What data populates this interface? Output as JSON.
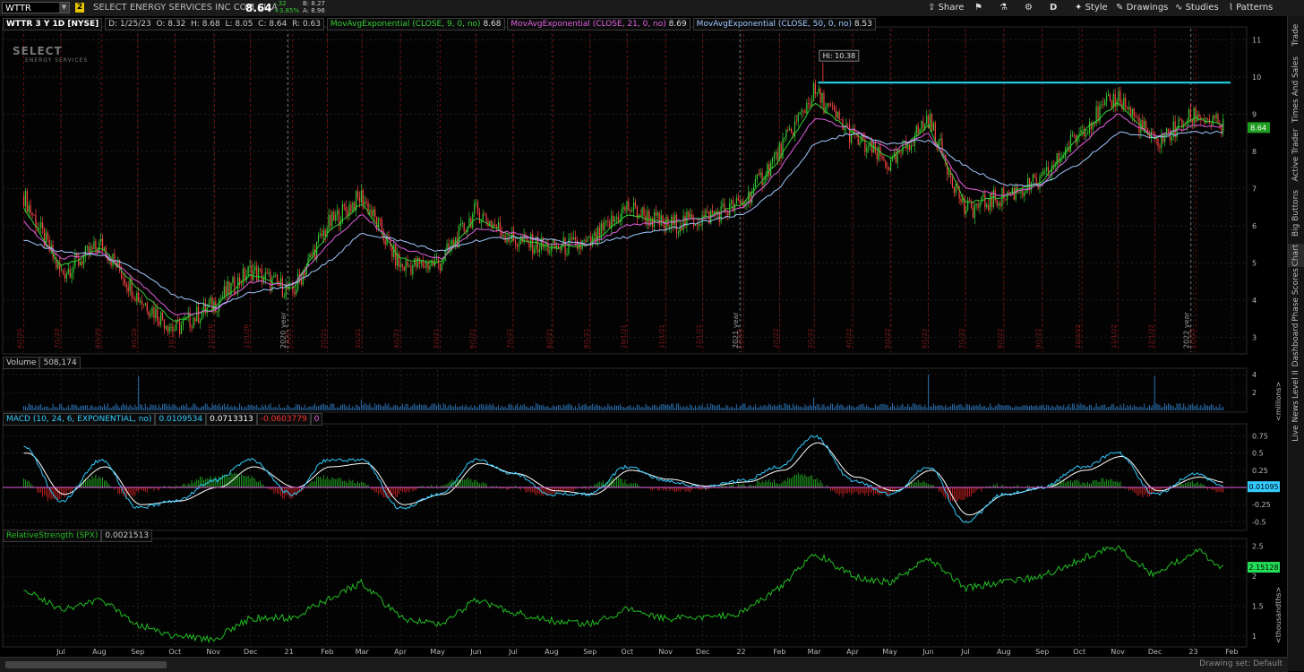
{
  "topbar": {
    "symbol": "WTTR",
    "link_number": "2",
    "company": "SELECT ENERGY SERVICES INC COM CL A",
    "last": "8.64",
    "change_abs": "-.32",
    "change_pct": "+3.85%",
    "bid": "B: 8.27",
    "ask": "A: 8.96",
    "share_label": "Share",
    "period_label": "D",
    "style_label": "Style",
    "drawings_label": "Drawings",
    "studies_label": "Studies",
    "patterns_label": "Patterns"
  },
  "price_pane": {
    "title": "WTTR 3 Y 1D [NYSE]",
    "ohlc": {
      "date": "D: 1/25/23",
      "open": "O: 8.32",
      "high": "H: 8.68",
      "low": "L: 8.05",
      "close": "C: 8.64",
      "range": "R: 0.63"
    },
    "studies": [
      {
        "label": "MovAvgExponential (CLOSE, 9, 0, no)",
        "value": "8.68",
        "color": "#33cc33"
      },
      {
        "label": "MovAvgExponential (CLOSE, 21, 0, no)",
        "value": "8.69",
        "color": "#e060e0"
      },
      {
        "label": "MovAvgExponential (CLOSE, 50, 0, no)",
        "value": "8.53",
        "color": "#a0c8ff"
      }
    ],
    "hi_label": "Hi: 10.38",
    "price_badge": "8.64",
    "watermark_line1": "SELECT",
    "watermark_line2": "ENERGY SERVICES",
    "y_ticks": [
      "11",
      "10",
      "9",
      "8",
      "7",
      "6",
      "5",
      "4",
      "3"
    ],
    "year_markers": [
      "2020 year",
      "2021 year",
      "2022 year"
    ],
    "date_markers": [
      "6/1/20",
      "7/1/20",
      "8/3/20",
      "9/1/20",
      "10/1/20",
      "11/2/20",
      "12/1/20",
      "1/4/21",
      "2/1/21",
      "3/1/21",
      "4/1/21",
      "5/3/21",
      "6/1/21",
      "7/1/21",
      "8/2/21",
      "9/1/21",
      "10/1/21",
      "11/1/21",
      "12/1/21",
      "1/3/22",
      "2/1/22",
      "3/1/22",
      "4/1/22",
      "5/2/22",
      "6/1/22",
      "7/1/22",
      "8/1/22",
      "9/1/22",
      "10/3/22",
      "11/1/22",
      "12/1/22",
      "1/3/23"
    ]
  },
  "volume_pane": {
    "title": "Volume",
    "value": "508,174",
    "y_ticks": [
      "4",
      "2"
    ],
    "unit_label": "<millions>"
  },
  "macd_pane": {
    "title": "MACD (10, 24, 6, EXPONENTIAL, no)",
    "values": [
      "0.0109534",
      "0.0713313",
      "-0.0603779",
      "0"
    ],
    "value_colors": [
      "#33ccff",
      "#ffffff",
      "#ff3333",
      "#e060e0"
    ],
    "y_ticks": [
      "0.75",
      "0.5",
      "0.25",
      "-0.25",
      "-0.5"
    ],
    "badge": "0.01095"
  },
  "rs_pane": {
    "title": "RelativeStrength (SPX)",
    "value": "0.0021513",
    "y_ticks": [
      "2.5",
      "2",
      "1.5",
      "1"
    ],
    "badge": "2.15128",
    "unit_label": "<thousandths>"
  },
  "x_axis": [
    "Jul",
    "Aug",
    "Sep",
    "Oct",
    "Nov",
    "Dec",
    "21",
    "Feb",
    "Mar",
    "Apr",
    "May",
    "Jun",
    "Jul",
    "Aug",
    "Sep",
    "Oct",
    "Nov",
    "Dec",
    "22",
    "Feb",
    "Mar",
    "Apr",
    "May",
    "Jun",
    "Jul",
    "Aug",
    "Sep",
    "Oct",
    "Nov",
    "Dec",
    "23",
    "Feb"
  ],
  "right_tabs": [
    "Trade",
    "Times And Sales",
    "Active Trader",
    "Big Buttons",
    "Chart",
    "Phase Scores",
    "Dashboard",
    "Level II",
    "Live News"
  ],
  "bottom": {
    "drawing_set": "Drawing set: Default"
  },
  "colors": {
    "up": "#33cc33",
    "down": "#ff4444",
    "ema9": "#33cc33",
    "ema21": "#e060e0",
    "ema50": "#a0c8ff",
    "resistance": "#22d3e6",
    "macd": "#33ccff",
    "signal": "#ffffff",
    "rs": "#22bb22"
  },
  "chart_data": [
    {
      "type": "candlestick",
      "title": "WTTR 3 Y 1D [NYSE]",
      "x": [
        "2020-06-01",
        "2020-07-01",
        "2020-08-03",
        "2020-09-01",
        "2020-10-01",
        "2020-11-02",
        "2020-12-01",
        "2021-01-04",
        "2021-02-01",
        "2021-03-01",
        "2021-04-01",
        "2021-05-03",
        "2021-06-01",
        "2021-07-01",
        "2021-08-02",
        "2021-09-01",
        "2021-10-01",
        "2021-11-01",
        "2021-12-01",
        "2022-01-03",
        "2022-02-01",
        "2022-03-01",
        "2022-04-01",
        "2022-05-02",
        "2022-06-01",
        "2022-07-01",
        "2022-08-01",
        "2022-09-01",
        "2022-10-03",
        "2022-11-01",
        "2022-12-01",
        "2023-01-03",
        "2023-01-25"
      ],
      "series": [
        {
          "name": "Close",
          "values": [
            6.8,
            4.7,
            5.5,
            4.1,
            3.2,
            3.9,
            4.8,
            4.2,
            6.0,
            6.8,
            4.9,
            5.0,
            6.4,
            5.6,
            5.4,
            5.5,
            6.5,
            6.0,
            6.2,
            6.6,
            8.0,
            9.6,
            8.4,
            7.6,
            8.9,
            6.4,
            6.8,
            7.2,
            8.6,
            9.5,
            8.2,
            9.0,
            8.64
          ]
        },
        {
          "name": "MovAvgExponential (CLOSE, 9, 0, no)",
          "values": [
            6.5,
            4.9,
            5.4,
            4.3,
            3.4,
            3.8,
            4.7,
            4.3,
            5.8,
            6.6,
            5.1,
            5.0,
            6.2,
            5.7,
            5.4,
            5.5,
            6.3,
            6.1,
            6.2,
            6.6,
            7.8,
            9.3,
            8.5,
            7.8,
            8.7,
            6.6,
            6.8,
            7.2,
            8.5,
            9.3,
            8.3,
            8.9,
            8.68
          ]
        },
        {
          "name": "MovAvgExponential (CLOSE, 21, 0, no)",
          "values": [
            6.1,
            5.1,
            5.3,
            4.5,
            3.6,
            3.7,
            4.5,
            4.4,
            5.5,
            6.3,
            5.4,
            5.1,
            5.9,
            5.8,
            5.5,
            5.5,
            6.0,
            6.1,
            6.2,
            6.5,
            7.5,
            8.9,
            8.6,
            8.0,
            8.5,
            7.0,
            6.8,
            7.1,
            8.2,
            9.0,
            8.4,
            8.7,
            8.69
          ]
        },
        {
          "name": "MovAvgExponential (CLOSE, 50, 0, no)",
          "values": [
            5.6,
            5.3,
            5.2,
            4.8,
            4.1,
            3.8,
            4.2,
            4.4,
            5.0,
            5.8,
            5.6,
            5.3,
            5.6,
            5.7,
            5.6,
            5.5,
            5.7,
            5.9,
            6.1,
            6.3,
            7.0,
            8.2,
            8.5,
            8.2,
            8.3,
            7.6,
            7.1,
            7.1,
            7.7,
            8.5,
            8.4,
            8.5,
            8.53
          ]
        }
      ],
      "resistance": 9.85,
      "annotation": {
        "x": "2022-03-08",
        "y": 10.38,
        "text": "Hi: 10.38"
      },
      "ylim": [
        2.6,
        11.3
      ]
    },
    {
      "type": "bar",
      "title": "Volume",
      "x": [
        "2020-06-01",
        "2020-09-01",
        "2020-12-01",
        "2021-03-01",
        "2021-06-01",
        "2021-09-01",
        "2021-12-01",
        "2022-03-01",
        "2022-06-01",
        "2022-09-01",
        "2022-12-01",
        "2023-01-25"
      ],
      "values": [
        0.6,
        3.8,
        0.5,
        1.2,
        0.6,
        0.4,
        0.6,
        1.4,
        4.0,
        0.8,
        3.8,
        0.51
      ],
      "ylim": [
        0,
        4.5
      ]
    },
    {
      "type": "line",
      "title": "MACD (10, 24, 6, EXPONENTIAL, no)",
      "x": [
        "2020-06-01",
        "2020-07-01",
        "2020-08-03",
        "2020-09-01",
        "2020-10-01",
        "2020-11-02",
        "2020-12-01",
        "2021-01-04",
        "2021-02-01",
        "2021-03-01",
        "2021-04-01",
        "2021-05-03",
        "2021-06-01",
        "2021-07-01",
        "2021-08-02",
        "2021-09-01",
        "2021-10-01",
        "2021-11-01",
        "2021-12-01",
        "2022-01-03",
        "2022-02-01",
        "2022-03-01",
        "2022-04-01",
        "2022-05-02",
        "2022-06-01",
        "2022-07-01",
        "2022-08-01",
        "2022-09-01",
        "2022-10-03",
        "2022-11-01",
        "2022-12-01",
        "2023-01-03",
        "2023-01-25"
      ],
      "series": [
        {
          "name": "Diff",
          "values": [
            0.6,
            -0.2,
            0.4,
            -0.3,
            -0.2,
            0.1,
            0.4,
            -0.1,
            0.4,
            0.4,
            -0.3,
            -0.1,
            0.4,
            0.2,
            -0.1,
            -0.1,
            0.3,
            0.1,
            0.0,
            0.1,
            0.3,
            0.75,
            0.1,
            -0.1,
            0.3,
            -0.5,
            -0.1,
            0.0,
            0.3,
            0.5,
            -0.1,
            0.2,
            0.011
          ]
        },
        {
          "name": "Avg",
          "values": [
            0.5,
            -0.1,
            0.3,
            -0.25,
            -0.2,
            0.0,
            0.3,
            0.0,
            0.3,
            0.35,
            -0.25,
            -0.1,
            0.35,
            0.2,
            -0.05,
            -0.1,
            0.25,
            0.12,
            0.02,
            0.08,
            0.25,
            0.65,
            0.15,
            -0.05,
            0.25,
            -0.4,
            -0.1,
            0.0,
            0.25,
            0.45,
            -0.05,
            0.15,
            0.071
          ]
        }
      ],
      "ylim": [
        -0.6,
        0.9
      ]
    },
    {
      "type": "line",
      "title": "RelativeStrength (SPX)",
      "x": [
        "2020-06-01",
        "2020-07-01",
        "2020-08-03",
        "2020-09-01",
        "2020-10-01",
        "2020-11-02",
        "2020-12-01",
        "2021-01-04",
        "2021-02-01",
        "2021-03-01",
        "2021-04-01",
        "2021-05-03",
        "2021-06-01",
        "2021-07-01",
        "2021-08-02",
        "2021-09-01",
        "2021-10-01",
        "2021-11-01",
        "2021-12-01",
        "2022-01-03",
        "2022-02-01",
        "2022-03-01",
        "2022-04-01",
        "2022-05-02",
        "2022-06-01",
        "2022-07-01",
        "2022-08-01",
        "2022-09-01",
        "2022-10-03",
        "2022-11-01",
        "2022-12-01",
        "2023-01-03",
        "2023-01-25"
      ],
      "series": [
        {
          "name": "RelativeStrength (SPX)",
          "values": [
            1.8,
            1.45,
            1.6,
            1.2,
            1.0,
            0.95,
            1.3,
            1.3,
            1.6,
            1.9,
            1.3,
            1.2,
            1.6,
            1.4,
            1.25,
            1.2,
            1.45,
            1.3,
            1.3,
            1.4,
            1.8,
            2.4,
            2.0,
            1.9,
            2.3,
            1.8,
            1.9,
            2.0,
            2.3,
            2.5,
            2.0,
            2.45,
            2.15
          ]
        }
      ],
      "ylim": [
        0.85,
        2.6
      ]
    }
  ]
}
